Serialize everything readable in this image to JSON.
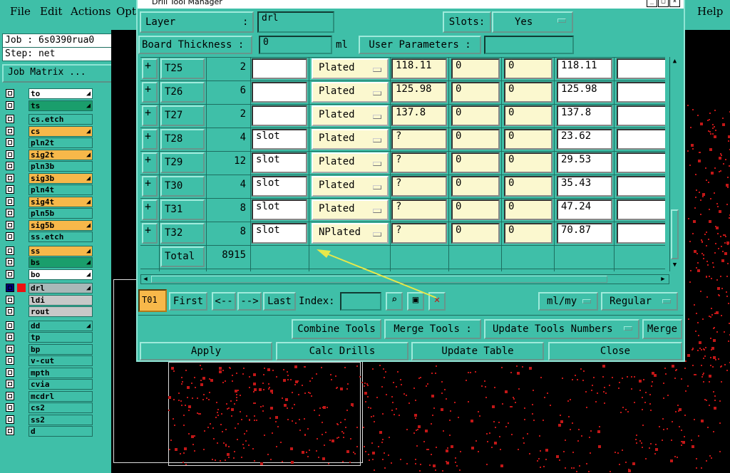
{
  "menus": [
    "File",
    "Edit",
    "Actions",
    "Opti",
    "Help"
  ],
  "job": {
    "label": "Job : 6s0390rua0",
    "step": "Step: net",
    "matrix_button": "Job Matrix ..."
  },
  "layers": [
    {
      "name": "to",
      "color": "#ffffff",
      "pin": true
    },
    {
      "name": "ts",
      "color": "#1a9e6c",
      "pin": true
    },
    {
      "name": "cs.etch",
      "color": "#3fbfa8",
      "pin": false
    },
    {
      "name": "cs",
      "color": "#f7b84a",
      "pin": true
    },
    {
      "name": "pln2t",
      "color": "#3fbfa8",
      "pin": false
    },
    {
      "name": "sig2t",
      "color": "#f7b84a",
      "pin": true
    },
    {
      "name": "pln3b",
      "color": "#3fbfa8",
      "pin": false
    },
    {
      "name": "sig3b",
      "color": "#f7b84a",
      "pin": true
    },
    {
      "name": "pln4t",
      "color": "#3fbfa8",
      "pin": false
    },
    {
      "name": "sig4t",
      "color": "#f7b84a",
      "pin": true
    },
    {
      "name": "pln5b",
      "color": "#3fbfa8",
      "pin": false
    },
    {
      "name": "sig5b",
      "color": "#f7b84a",
      "pin": true
    },
    {
      "name": "ss.etch",
      "color": "#3fbfa8",
      "pin": false
    },
    {
      "name": "ss",
      "color": "#f7b84a",
      "pin": true
    },
    {
      "name": "bs",
      "color": "#1a9e6c",
      "pin": true
    },
    {
      "name": "bo",
      "color": "#ffffff",
      "pin": true
    },
    {
      "name": "drl",
      "color": "#a8b8b8",
      "pin": true
    },
    {
      "name": "ldi",
      "color": "#c8c8c8",
      "pin": false
    },
    {
      "name": "rout",
      "color": "#c8c8c8",
      "pin": false
    },
    {
      "name": "dd",
      "color": "#3fbfa8",
      "pin": true
    },
    {
      "name": "tp",
      "color": "#3fbfa8",
      "pin": false
    },
    {
      "name": "bp",
      "color": "#3fbfa8",
      "pin": false
    },
    {
      "name": "v-cut",
      "color": "#3fbfa8",
      "pin": false
    },
    {
      "name": "mpth",
      "color": "#3fbfa8",
      "pin": false
    },
    {
      "name": "cvia",
      "color": "#3fbfa8",
      "pin": false
    },
    {
      "name": "mcdrl",
      "color": "#3fbfa8",
      "pin": false
    },
    {
      "name": "cs2",
      "color": "#3fbfa8",
      "pin": false
    },
    {
      "name": "ss2",
      "color": "#3fbfa8",
      "pin": false
    },
    {
      "name": "d",
      "color": "#3fbfa8",
      "pin": false
    }
  ],
  "dialog": {
    "title": "Drill Tool Manager",
    "layer_label": "Layer",
    "layer_value": "drl",
    "slots_label": "Slots:",
    "slots_value": "Yes",
    "board_label": "Board Thickness :",
    "board_value": "0",
    "board_unit": "ml",
    "user_params": "User Parameters :",
    "tools": [
      {
        "name": "T25",
        "count": "2",
        "type": "",
        "plated": "Plated",
        "size": "118.11",
        "v1": "0",
        "v2": "0",
        "finish": "118.11"
      },
      {
        "name": "T26",
        "count": "6",
        "type": "",
        "plated": "Plated",
        "size": "125.98",
        "v1": "0",
        "v2": "0",
        "finish": "125.98"
      },
      {
        "name": "T27",
        "count": "2",
        "type": "",
        "plated": "Plated",
        "size": "137.8",
        "v1": "0",
        "v2": "0",
        "finish": "137.8"
      },
      {
        "name": "T28",
        "count": "4",
        "type": "slot",
        "plated": "Plated",
        "size": "?",
        "v1": "0",
        "v2": "0",
        "finish": "23.62"
      },
      {
        "name": "T29",
        "count": "12",
        "type": "slot",
        "plated": "Plated",
        "size": "?",
        "v1": "0",
        "v2": "0",
        "finish": "29.53"
      },
      {
        "name": "T30",
        "count": "4",
        "type": "slot",
        "plated": "Plated",
        "size": "?",
        "v1": "0",
        "v2": "0",
        "finish": "35.43"
      },
      {
        "name": "T31",
        "count": "8",
        "type": "slot",
        "plated": "Plated",
        "size": "?",
        "v1": "0",
        "v2": "0",
        "finish": "47.24"
      },
      {
        "name": "T32",
        "count": "8",
        "type": "slot",
        "plated": "NPlated",
        "size": "?",
        "v1": "0",
        "v2": "0",
        "finish": "70.87"
      }
    ],
    "total_label": "Total",
    "total_value": "8915",
    "current_tool": "T01",
    "nav": {
      "first": "First",
      "prev": "<--",
      "next": "-->",
      "last": "Last",
      "index": "Index:"
    },
    "units": "ml/my",
    "mode": "Regular",
    "combine": "Combine Tools",
    "merge_label": "Merge Tools :",
    "merge_value": "Update Tools Numbers",
    "merge_btn": "Merge",
    "apply": "Apply",
    "calc": "Calc Drills",
    "update": "Update Table",
    "close": "Close"
  },
  "colors": {
    "dialog_bg": "#3fbfa8",
    "pad": "#c21717",
    "yellow_cell": "#fbf8cf",
    "arrow": "#e8e84a"
  }
}
